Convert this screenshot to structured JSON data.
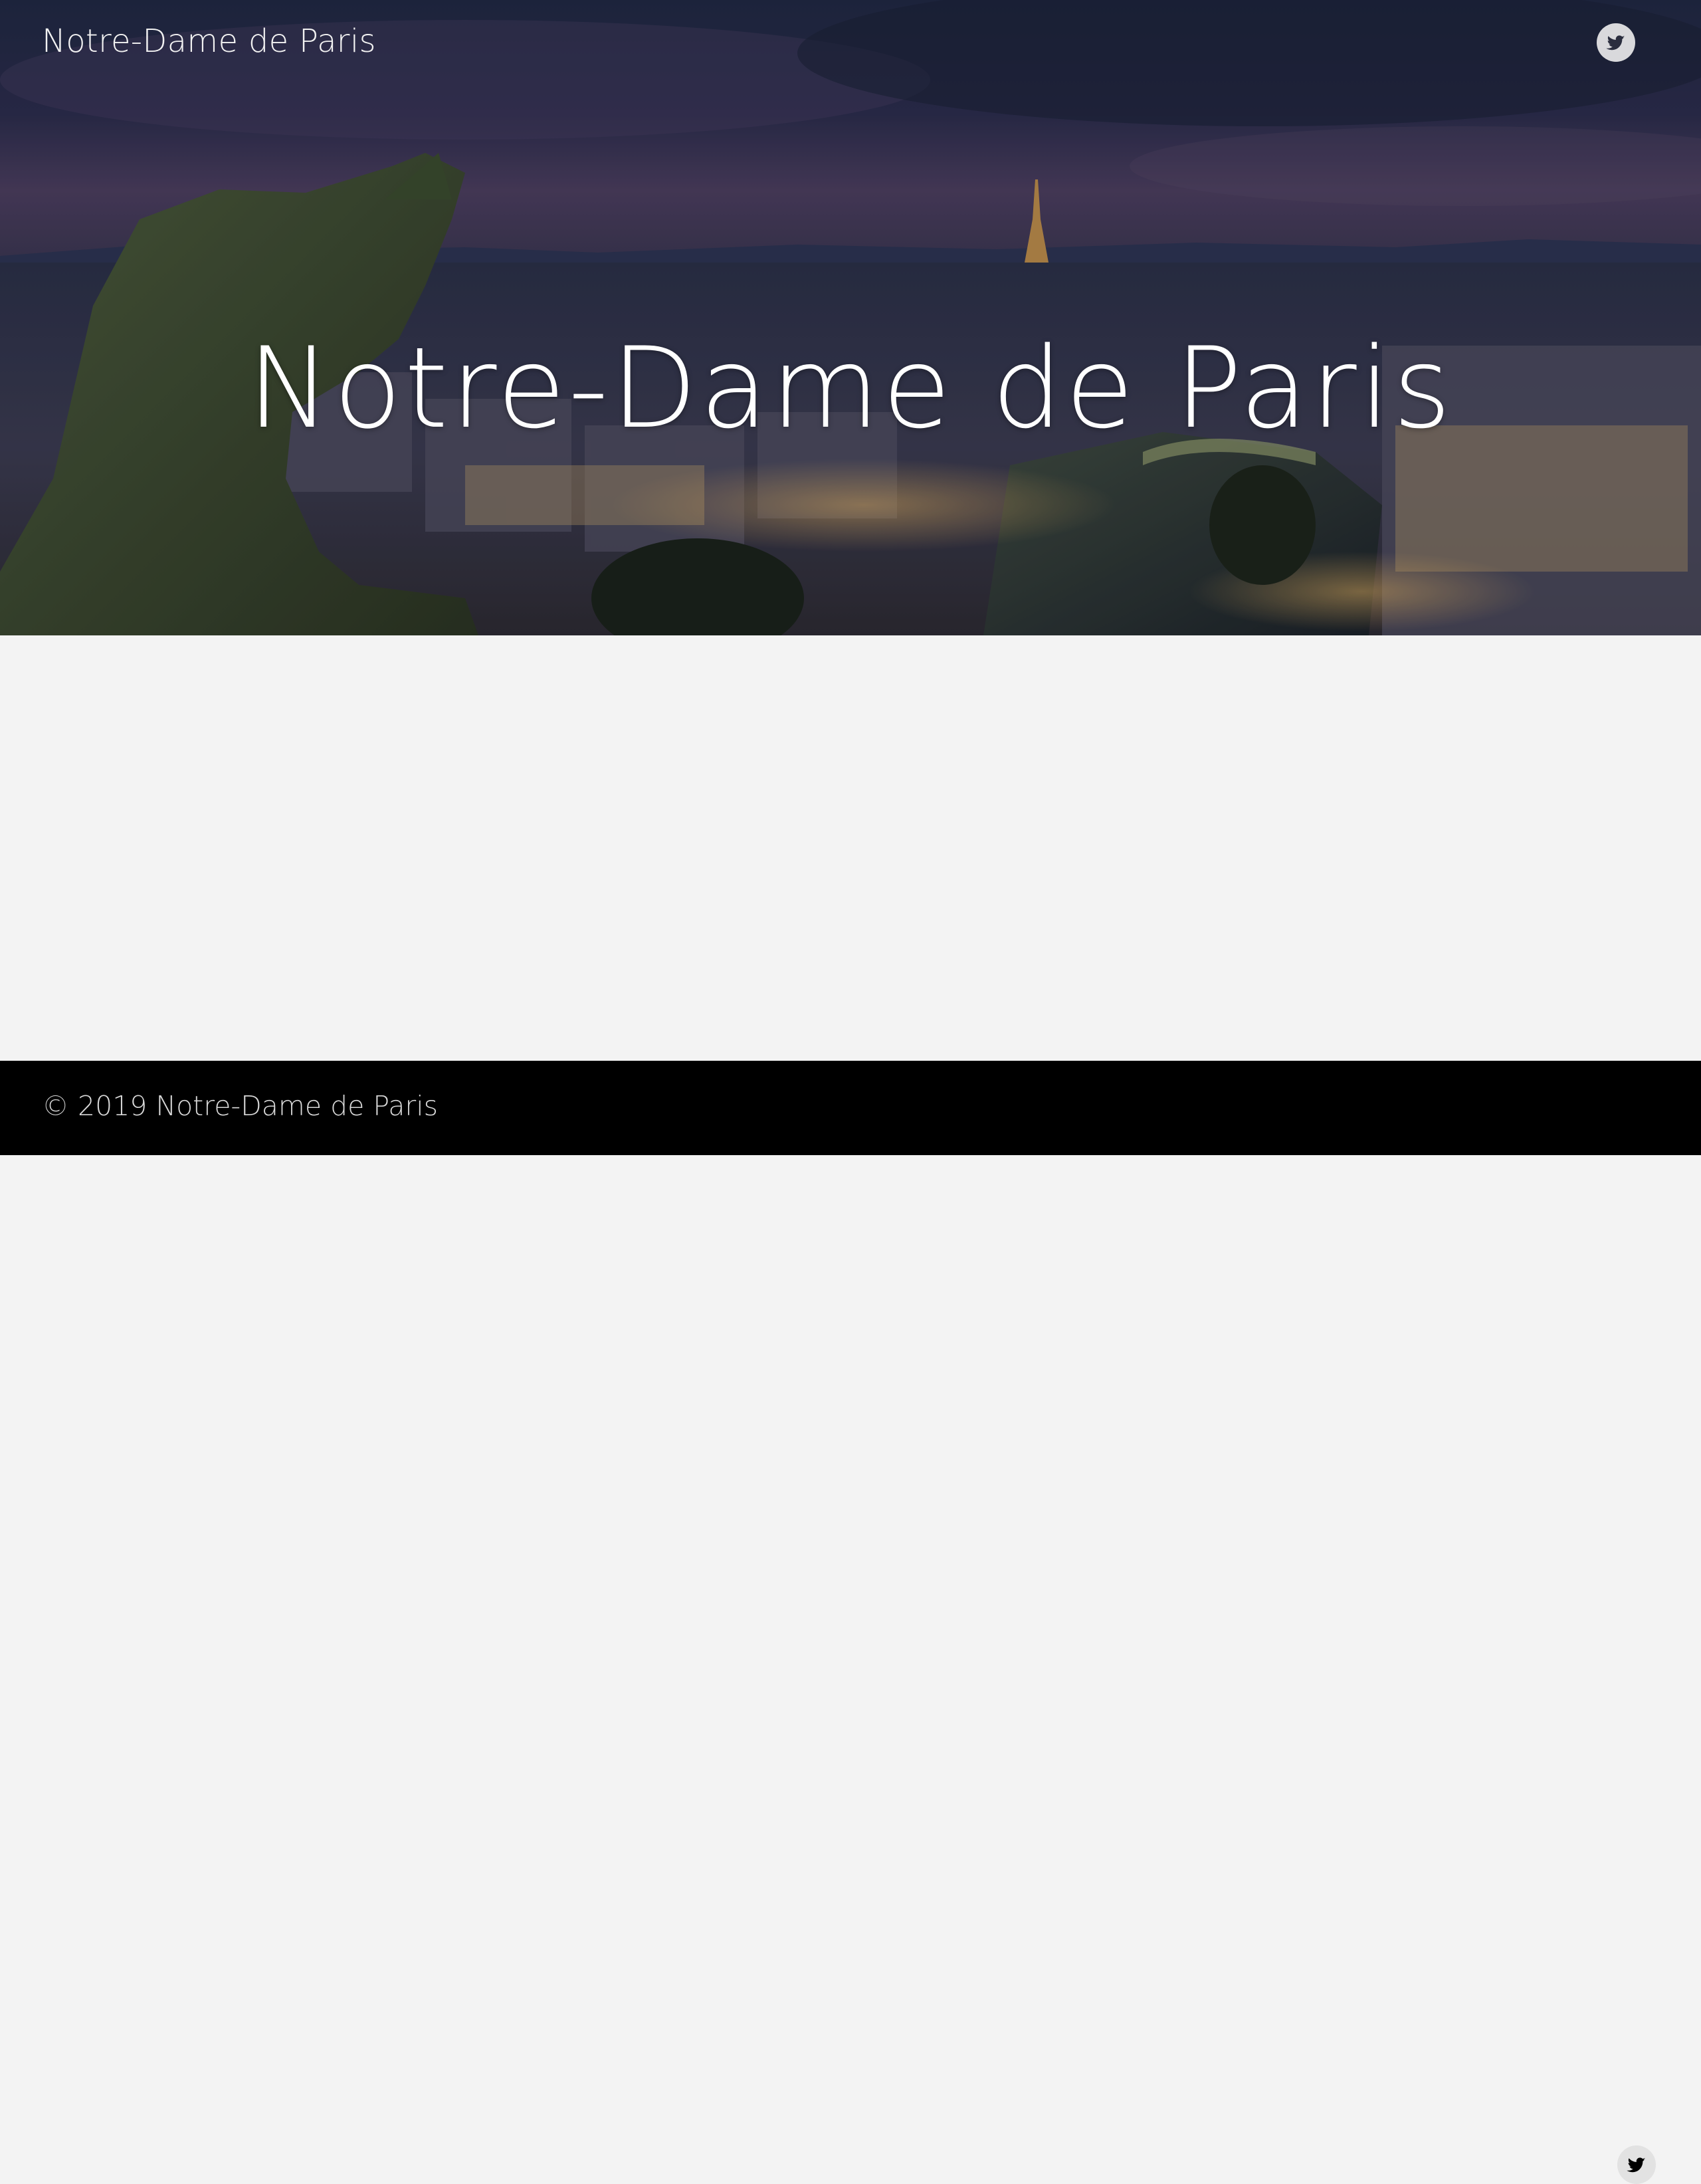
{
  "header": {
    "site_name": "Notre-Dame de Paris",
    "social": {
      "icon": "twitter-icon"
    }
  },
  "hero": {
    "title": "Notre-Dame de Paris",
    "background": "night-panorama-of-paris-with-gargoyle"
  },
  "footer": {
    "copyright": "© 2019 Notre-Dame de Paris",
    "social": {
      "icon": "twitter-icon"
    }
  },
  "colors": {
    "hero_overlay": "#1c2036",
    "page_background": "#f3f3f3",
    "footer_background": "#000000",
    "icon_circle": "#d9d9dc"
  }
}
